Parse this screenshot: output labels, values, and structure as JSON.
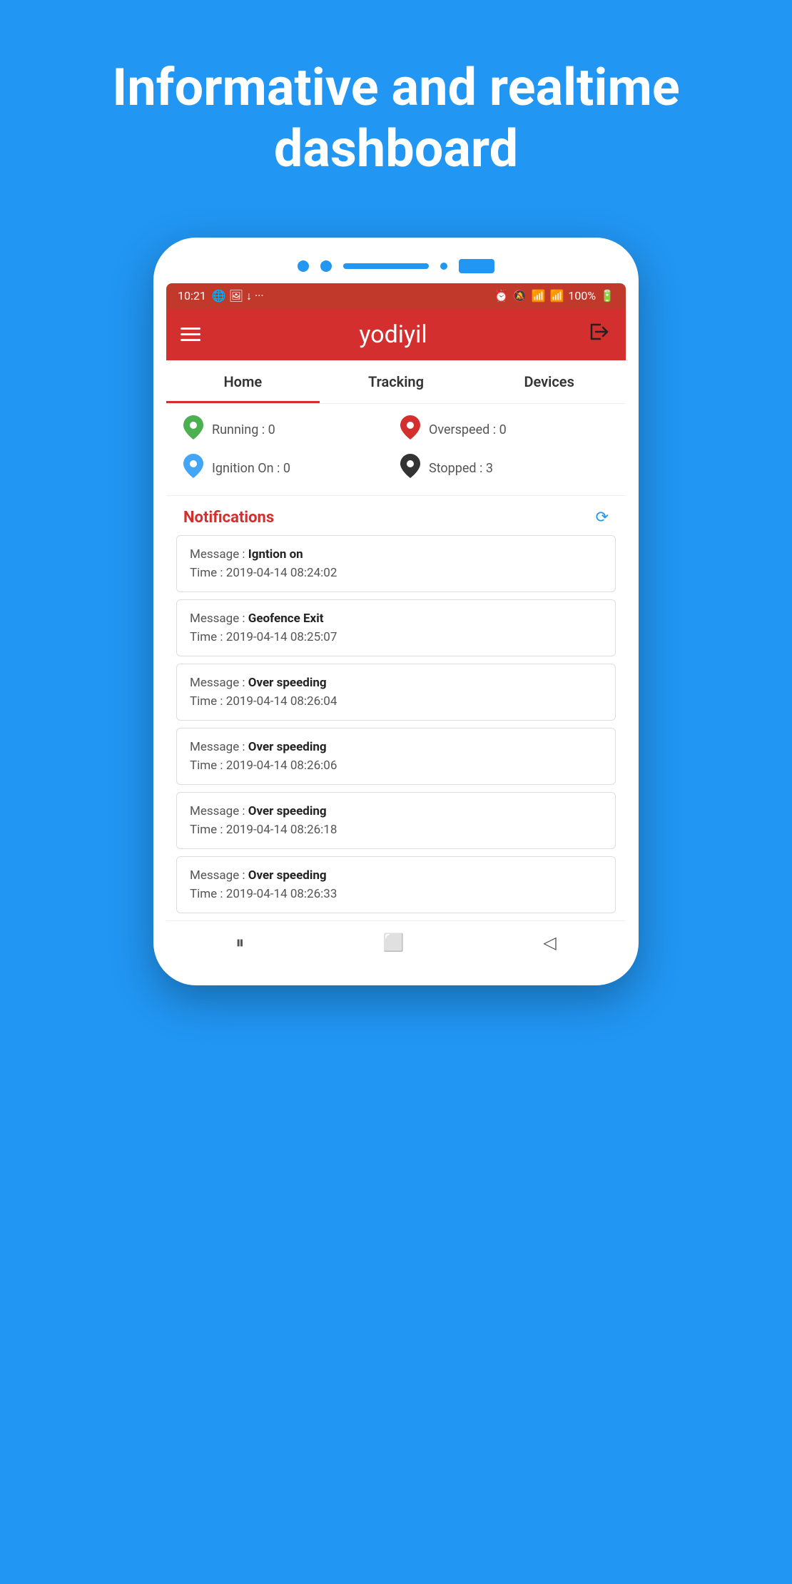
{
  "hero": {
    "title": "Informative and realtime dashboard"
  },
  "phone": {
    "status_bar": {
      "time": "10:21",
      "battery": "100%"
    },
    "header": {
      "app_name": "yodiyil"
    },
    "nav_tabs": [
      {
        "label": "Home",
        "active": true
      },
      {
        "label": "Tracking",
        "active": false
      },
      {
        "label": "Devices",
        "active": false
      }
    ],
    "stats": [
      {
        "label": "Running :",
        "value": "0",
        "color": "green",
        "icon": "📍"
      },
      {
        "label": "Overspeed :",
        "value": "0",
        "color": "red",
        "icon": "📍"
      },
      {
        "label": "Ignition On :",
        "value": "0",
        "color": "blue",
        "icon": "📍"
      },
      {
        "label": "Stopped :",
        "value": "3",
        "color": "dark",
        "icon": "📍"
      }
    ],
    "notifications": {
      "section_title": "Notifications",
      "items": [
        {
          "message_label": "Message :",
          "message_value": "Igntion on",
          "time_label": "Time :",
          "time_value": "2019-04-14 08:24:02"
        },
        {
          "message_label": "Message :",
          "message_value": "Geofence Exit",
          "time_label": "Time :",
          "time_value": "2019-04-14 08:25:07"
        },
        {
          "message_label": "Message :",
          "message_value": "Over speeding",
          "time_label": "Time :",
          "time_value": "2019-04-14 08:26:04"
        },
        {
          "message_label": "Message :",
          "message_value": "Over speeding",
          "time_label": "Time :",
          "time_value": "2019-04-14 08:26:06"
        },
        {
          "message_label": "Message :",
          "message_value": "Over speeding",
          "time_label": "Time :",
          "time_value": "2019-04-14 08:26:18"
        },
        {
          "message_label": "Message :",
          "message_value": "Over speeding",
          "time_label": "Time :",
          "time_value": "2019-04-14 08:26:33"
        }
      ]
    }
  }
}
